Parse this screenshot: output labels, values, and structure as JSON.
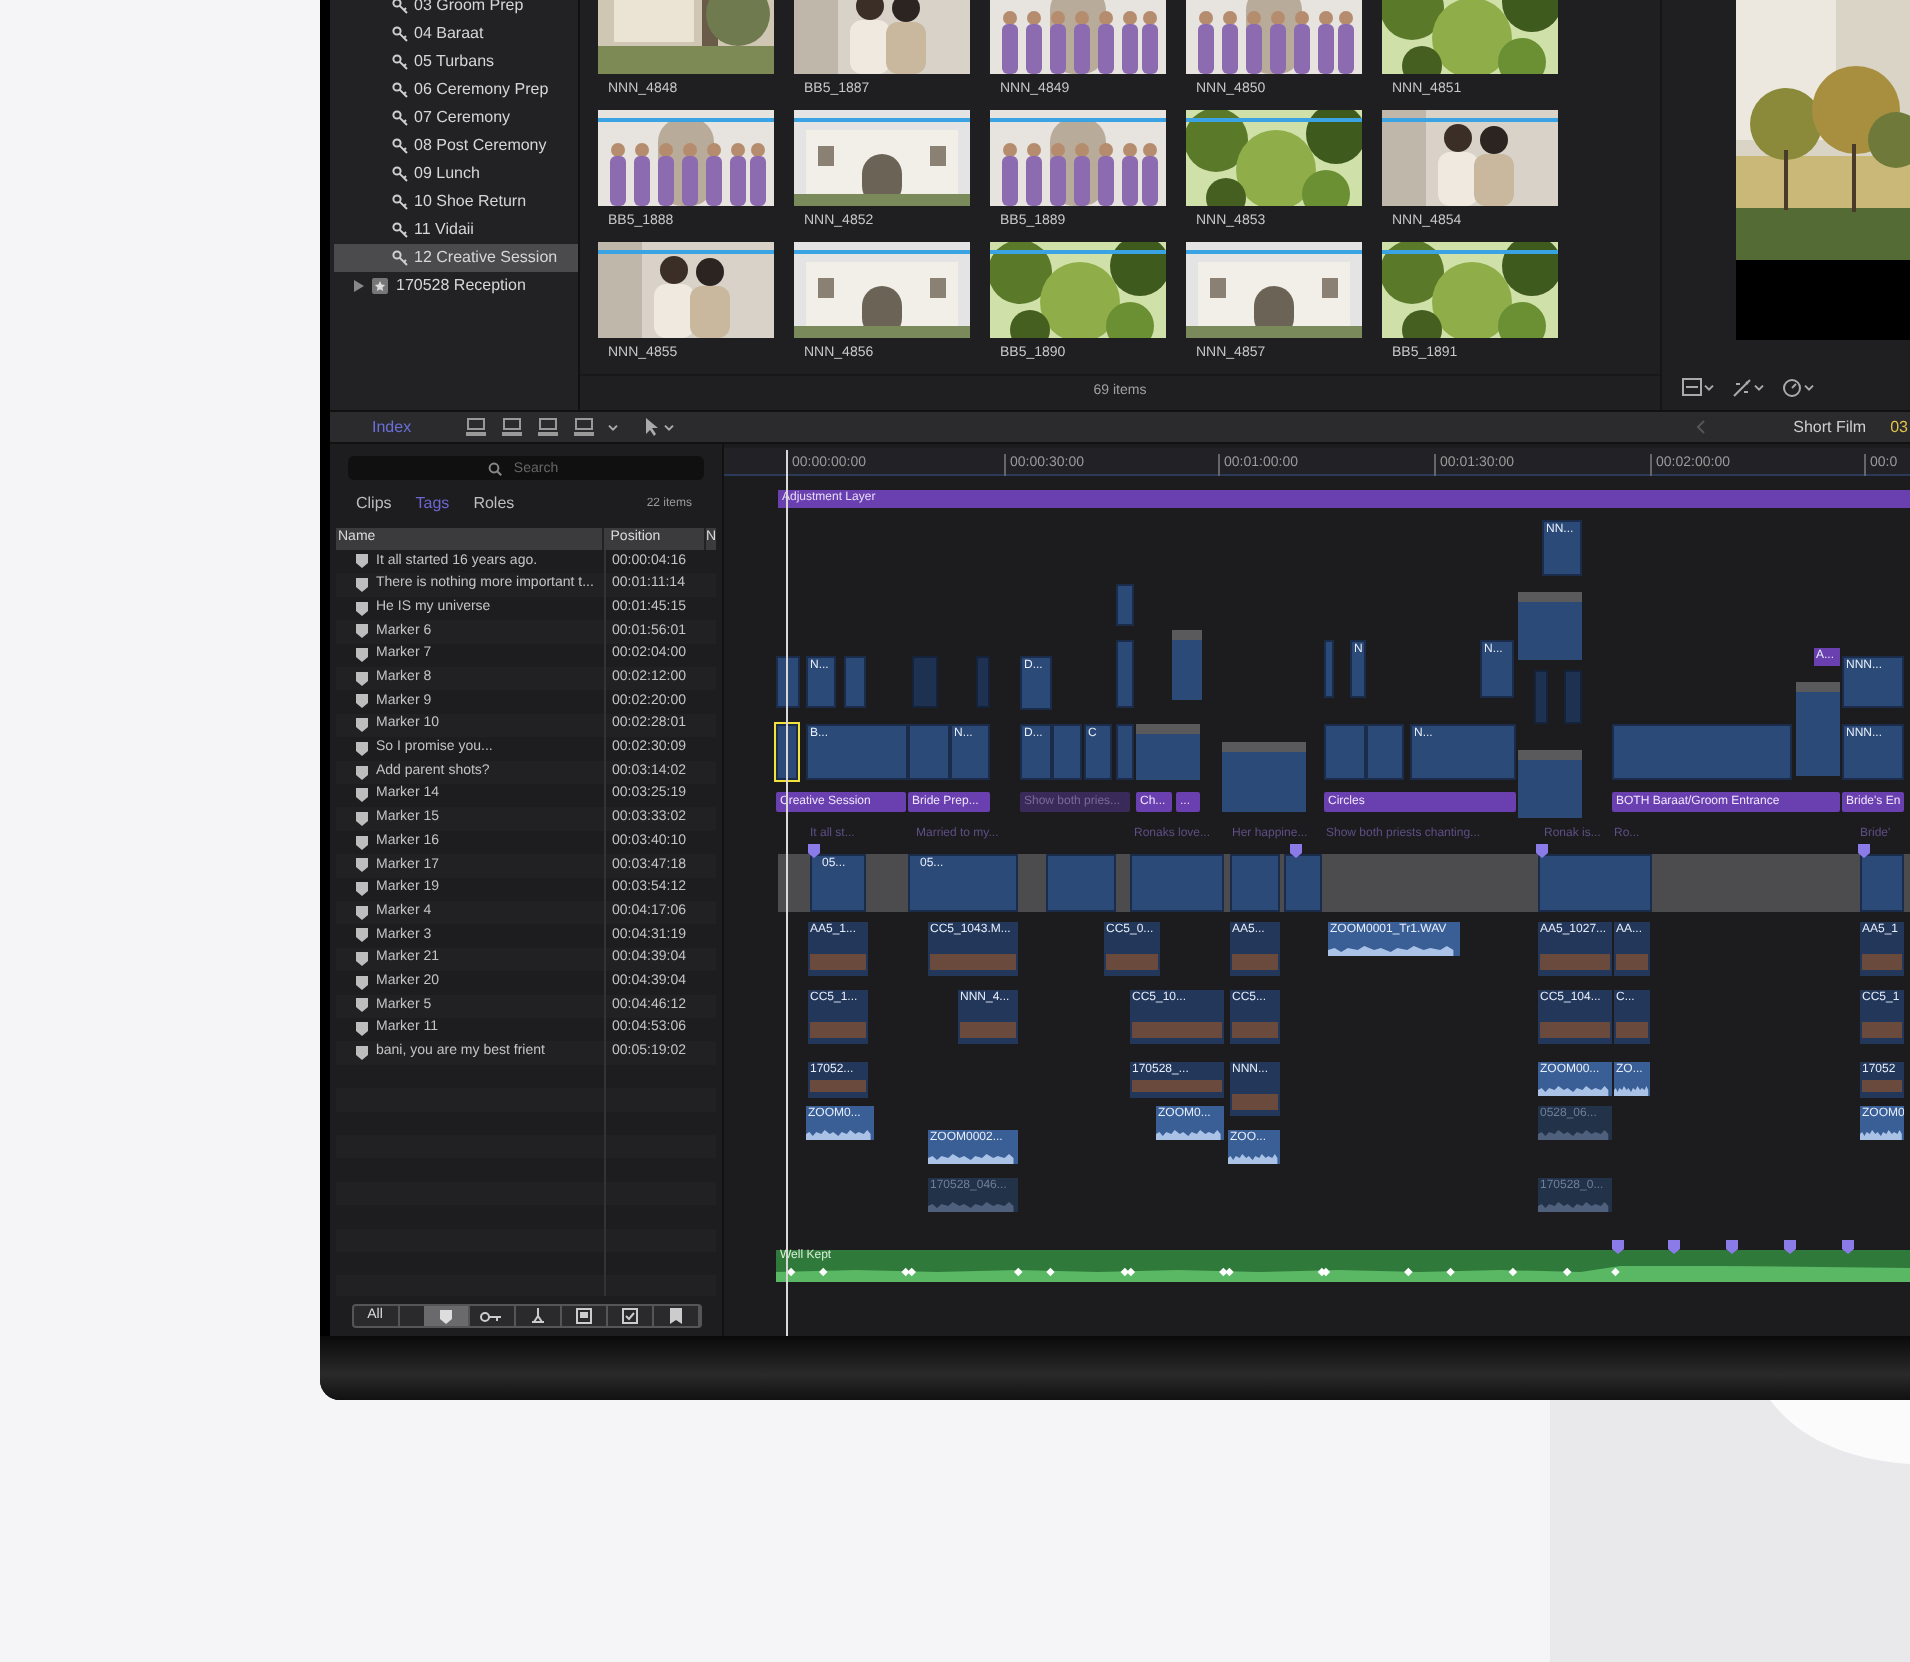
{
  "browser_sidebar": {
    "items": [
      {
        "label": "03 Groom Prep",
        "kind": "keyword",
        "selected": false
      },
      {
        "label": "04 Baraat",
        "kind": "keyword",
        "selected": false
      },
      {
        "label": "05 Turbans",
        "kind": "keyword",
        "selected": false
      },
      {
        "label": "06 Ceremony Prep",
        "kind": "keyword",
        "selected": false
      },
      {
        "label": "07 Ceremony",
        "kind": "keyword",
        "selected": false
      },
      {
        "label": "08 Post Ceremony",
        "kind": "keyword",
        "selected": false
      },
      {
        "label": "09 Lunch",
        "kind": "keyword",
        "selected": false
      },
      {
        "label": "10 Shoe Return",
        "kind": "keyword",
        "selected": false
      },
      {
        "label": "11 Vidaii",
        "kind": "keyword",
        "selected": false
      },
      {
        "label": "12 Creative Session",
        "kind": "keyword",
        "selected": true
      },
      {
        "label": "170528 Reception",
        "kind": "event",
        "selected": false
      }
    ]
  },
  "browser": {
    "clips": [
      {
        "label": "NNN_4848"
      },
      {
        "label": "BB5_1887"
      },
      {
        "label": "NNN_4849"
      },
      {
        "label": "NNN_4850"
      },
      {
        "label": "NNN_4851"
      },
      {
        "label": "BB5_1888",
        "tagged": true
      },
      {
        "label": "NNN_4852",
        "tagged": true
      },
      {
        "label": "BB5_1889",
        "tagged": true
      },
      {
        "label": "NNN_4853",
        "tagged": true
      },
      {
        "label": "NNN_4854",
        "tagged": true
      },
      {
        "label": "NNN_4855",
        "tagged": true
      },
      {
        "label": "NNN_4856",
        "tagged": true
      },
      {
        "label": "BB5_1890",
        "tagged": true
      },
      {
        "label": "NNN_4857",
        "tagged": true
      },
      {
        "label": "BB5_1891",
        "tagged": true
      }
    ],
    "count": "69 items"
  },
  "timeline_toolbar": {
    "index_button": {
      "label": "Index",
      "selected": true
    },
    "project": "Short Film",
    "timecode": "03"
  },
  "index": {
    "search": {
      "placeholder": "Search"
    },
    "tabs": [
      {
        "label": "Clips",
        "selected": false
      },
      {
        "label": "Tags",
        "selected": true
      },
      {
        "label": "Roles",
        "selected": false
      }
    ],
    "count": "22 items",
    "columns": [
      "Name",
      "Position",
      "N"
    ],
    "rows": [
      {
        "name": "It all started 16 years ago.",
        "position": "00:00:04:16"
      },
      {
        "name": "There is nothing more important t...",
        "position": "00:01:11:14"
      },
      {
        "name": "He IS my universe",
        "position": "00:01:45:15"
      },
      {
        "name": "Marker 6",
        "position": "00:01:56:01"
      },
      {
        "name": "Marker 7",
        "position": "00:02:04:00"
      },
      {
        "name": "Marker 8",
        "position": "00:02:12:00"
      },
      {
        "name": "Marker 9",
        "position": "00:02:20:00"
      },
      {
        "name": "Marker 10",
        "position": "00:02:28:01"
      },
      {
        "name": "So I promise you...",
        "position": "00:02:30:09"
      },
      {
        "name": "Add parent shots?",
        "position": "00:03:14:02"
      },
      {
        "name": "Marker 14",
        "position": "00:03:25:19"
      },
      {
        "name": "Marker 15",
        "position": "00:03:33:02"
      },
      {
        "name": "Marker 16",
        "position": "00:03:40:10"
      },
      {
        "name": "Marker 17",
        "position": "00:03:47:18"
      },
      {
        "name": "Marker 19",
        "position": "00:03:54:12"
      },
      {
        "name": "Marker 4",
        "position": "00:04:17:06"
      },
      {
        "name": "Marker 3",
        "position": "00:04:31:19"
      },
      {
        "name": "Marker 21",
        "position": "00:04:39:04"
      },
      {
        "name": "Marker 20",
        "position": "00:04:39:04"
      },
      {
        "name": "Marker 5",
        "position": "00:04:46:12"
      },
      {
        "name": "Marker 11",
        "position": "00:04:53:06"
      },
      {
        "name": "bani, you are my best frient",
        "position": "00:05:19:02"
      }
    ],
    "filters": [
      {
        "kind": "all",
        "label": "All",
        "selected": false
      },
      {
        "kind": "marker",
        "selected": true
      },
      {
        "kind": "keyword",
        "selected": false
      },
      {
        "kind": "analysis",
        "selected": false
      },
      {
        "kind": "todo",
        "selected": false
      },
      {
        "kind": "done",
        "selected": false
      },
      {
        "kind": "chapter",
        "selected": false
      }
    ]
  },
  "timeline": {
    "ruler": [
      "00:00:00:00",
      "00:00:30:00",
      "00:01:00:00",
      "00:01:30:00",
      "00:02:00:00",
      "00:0"
    ],
    "adjustment_layer": "Adjustment Layer",
    "connected_clips": [
      {
        "label": "N..."
      },
      {
        "label": "D..."
      },
      {
        "label": "N"
      },
      {
        "label": "N..."
      },
      {
        "label": "NN..."
      },
      {
        "label": "A..."
      },
      {
        "label": "NNN..."
      }
    ],
    "storyline_clips": [
      {
        "selected": true
      },
      {
        "label": "B...",
        "selected": false
      },
      {
        "selected": false
      },
      {
        "label": "N...",
        "selected": false
      },
      {
        "label": "D...",
        "selected": false
      },
      {
        "selected": false
      },
      {
        "label": "C",
        "selected": false
      },
      {
        "selected": false
      },
      {
        "selected": false
      },
      {
        "selected": false
      },
      {
        "selected": false
      },
      {
        "selected": false
      },
      {
        "label": "N...",
        "selected": false
      },
      {
        "selected": false
      },
      {
        "selected": false
      },
      {
        "label": "NNN...",
        "selected": false
      }
    ],
    "titles": [
      {
        "label": "Creative Session",
        "muted": false
      },
      {
        "label": "Bride Prep...",
        "muted": false
      },
      {
        "label": "Show both pries...",
        "muted": true
      },
      {
        "label": "Ch...",
        "muted": false
      },
      {
        "label": "...",
        "muted": false
      },
      {
        "label": "Circles",
        "muted": false
      },
      {
        "label": "BOTH Baraat/Groom Entrance",
        "muted": false
      },
      {
        "label": "Bride's En",
        "muted": false
      }
    ],
    "notes": [
      "It all st...",
      "Married to my...",
      "Ronaks love...",
      "Her happine...",
      "Show both priests chanting...",
      "Ronak is...",
      "Ro...",
      "Bride'"
    ],
    "primary_clips": [
      {
        "label": "05..."
      },
      {
        "label": "05..."
      }
    ],
    "lower_clips": [
      {
        "label": "AA5_1...",
        "kind": "video",
        "dimmed": false
      },
      {
        "label": "CC5_1043.M...",
        "kind": "video",
        "dimmed": false
      },
      {
        "label": "CC5_0...",
        "kind": "video",
        "dimmed": false
      },
      {
        "label": "AA5...",
        "kind": "video",
        "dimmed": false
      },
      {
        "label": "ZOOM0001_Tr1.WAV",
        "kind": "audio",
        "dimmed": false
      },
      {
        "label": "AA5_1027...",
        "kind": "video",
        "dimmed": false
      },
      {
        "label": "AA...",
        "kind": "video",
        "dimmed": false
      },
      {
        "label": "AA5_1",
        "kind": "video",
        "dimmed": false
      },
      {
        "label": "CC5_1...",
        "kind": "video",
        "dimmed": false
      },
      {
        "label": "NNN_4...",
        "kind": "video",
        "dimmed": false
      },
      {
        "label": "CC5_10...",
        "kind": "video",
        "dimmed": false
      },
      {
        "label": "CC5...",
        "kind": "video",
        "dimmed": false
      },
      {
        "label": "CC5_104...",
        "kind": "video",
        "dimmed": false
      },
      {
        "label": "C...",
        "kind": "video",
        "dimmed": false
      },
      {
        "label": "CC5_1",
        "kind": "video",
        "dimmed": false
      },
      {
        "label": "17052...",
        "kind": "video",
        "dimmed": false
      },
      {
        "label": "170528_...",
        "kind": "video",
        "dimmed": false
      },
      {
        "label": "NNN...",
        "kind": "video",
        "dimmed": false
      },
      {
        "label": "ZOOM00...",
        "kind": "audio",
        "dimmed": false
      },
      {
        "label": "ZO...",
        "kind": "audio",
        "dimmed": false
      },
      {
        "label": "17052",
        "kind": "video",
        "dimmed": false
      },
      {
        "label": "ZOOM0...",
        "kind": "audio",
        "dimmed": false
      },
      {
        "label": "ZOOM0...",
        "kind": "audio",
        "dimmed": false
      },
      {
        "label": "0528_06...",
        "kind": "audio",
        "dimmed": true
      },
      {
        "label": "ZOOM0",
        "kind": "audio",
        "dimmed": false
      },
      {
        "label": "ZOOM0002...",
        "kind": "audio",
        "dimmed": false
      },
      {
        "label": "ZOO...",
        "kind": "audio",
        "dimmed": false
      },
      {
        "label": "170528_046...",
        "kind": "audio",
        "dimmed": true
      },
      {
        "label": "170528_0...",
        "kind": "audio",
        "dimmed": true
      }
    ],
    "music": "Well Kept"
  }
}
